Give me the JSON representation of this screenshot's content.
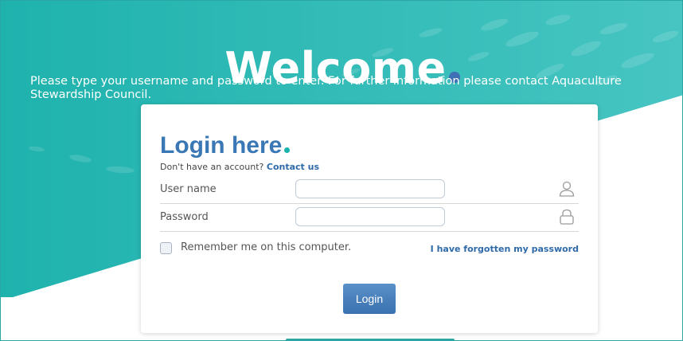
{
  "header": {
    "title": "Welcome",
    "intro": "Please type your username and password to enter. For further information please contact Aquaculture Stewardship Council."
  },
  "login": {
    "title": "Login here",
    "no_account_text": "Don't have an account?",
    "contact_link": "Contact us",
    "username_label": "User name",
    "username_value": "",
    "password_label": "Password",
    "password_value": "",
    "remember_label": "Remember me on this computer.",
    "remember_checked": false,
    "forgot_link": "I have forgotten my password",
    "submit_label": "Login"
  },
  "icons": {
    "username": "user-icon",
    "password": "lock-icon"
  },
  "colors": {
    "teal_background": "#2fb8b3",
    "title_blue": "#3a78b5",
    "accent_dot_blue": "#3f6fb5",
    "accent_dot_teal": "#19b3ae",
    "button_blue": "#4a82bf"
  }
}
